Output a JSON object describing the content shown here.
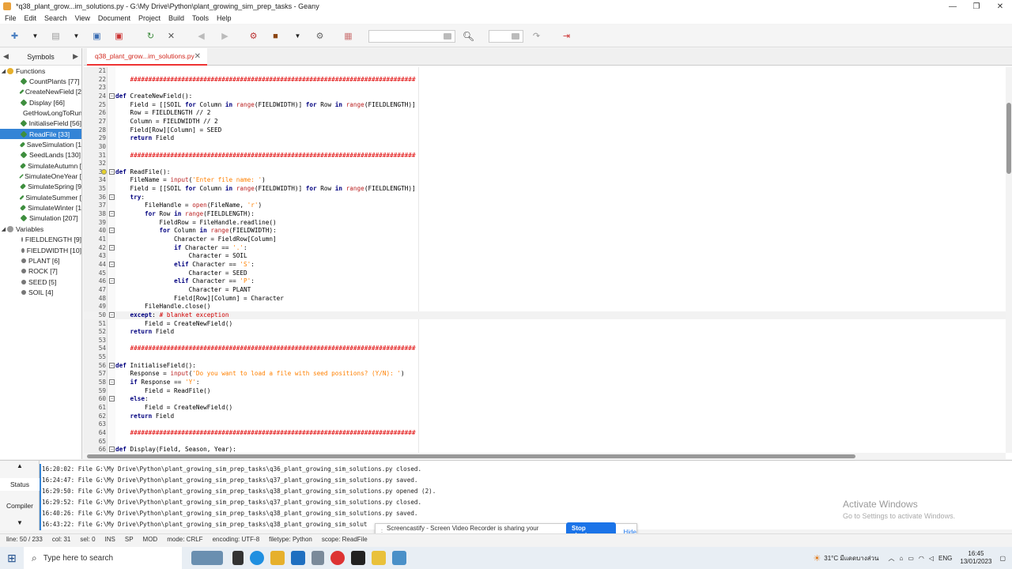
{
  "window": {
    "title": "*q38_plant_grow...im_solutions.py - G:\\My Drive\\Python\\plant_growing_sim_prep_tasks - Geany",
    "controls": [
      "—",
      "❐",
      "✕"
    ]
  },
  "menu": [
    "File",
    "Edit",
    "Search",
    "View",
    "Document",
    "Project",
    "Build",
    "Tools",
    "Help"
  ],
  "sidebar": {
    "tab_label": "Symbols",
    "groups": [
      {
        "label": "Functions",
        "items": [
          "CountPlants [77]",
          "CreateNewField [2",
          "Display [66]",
          "GetHowLongToRun",
          "InitialiseField [56]",
          "ReadFile [33]",
          "SaveSimulation [1",
          "SeedLands [130]",
          "SimulateAutumn [",
          "SimulateOneYear [",
          "SimulateSpring [9",
          "SimulateSummer [",
          "SimulateWinter [1",
          "Simulation [207]"
        ]
      },
      {
        "label": "Variables",
        "items": [
          "FIELDLENGTH [9]",
          "FIELDWIDTH [10]",
          "PLANT [6]",
          "ROCK [7]",
          "SEED [5]",
          "SOIL [4]"
        ]
      }
    ],
    "selected": "ReadFile [33]"
  },
  "editor": {
    "tab_label": "q38_plant_grow...im_solutions.py",
    "current_line": 50,
    "lines": [
      {
        "n": "21",
        "t": "",
        "f": false
      },
      {
        "n": "22",
        "t": "    ##############################################################################",
        "f": false
      },
      {
        "n": "23",
        "t": "",
        "f": false
      },
      {
        "n": "24",
        "t": "def CreateNewField():",
        "f": true
      },
      {
        "n": "25",
        "t": "    Field = [[SOIL for Column in range(FIELDWIDTH)] for Row in range(FIELDLENGTH)]",
        "f": false
      },
      {
        "n": "26",
        "t": "    Row = FIELDLENGTH // 2",
        "f": false
      },
      {
        "n": "27",
        "t": "    Column = FIELDWIDTH // 2",
        "f": false
      },
      {
        "n": "28",
        "t": "    Field[Row][Column] = SEED",
        "f": false
      },
      {
        "n": "29",
        "t": "    return Field",
        "f": false
      },
      {
        "n": "30",
        "t": "",
        "f": false
      },
      {
        "n": "31",
        "t": "    ##############################################################################",
        "f": false
      },
      {
        "n": "32",
        "t": "",
        "f": false
      },
      {
        "n": "33",
        "t": "def ReadFile():",
        "f": true
      },
      {
        "n": "34",
        "t": "    FileName = input('Enter file name: ')",
        "f": false
      },
      {
        "n": "35",
        "t": "    Field = [[SOIL for Column in range(FIELDWIDTH)] for Row in range(FIELDLENGTH)]",
        "f": false
      },
      {
        "n": "36",
        "t": "    try:",
        "f": true
      },
      {
        "n": "37",
        "t": "        FileHandle = open(FileName, 'r')",
        "f": false
      },
      {
        "n": "38",
        "t": "        for Row in range(FIELDLENGTH):",
        "f": true
      },
      {
        "n": "39",
        "t": "            FieldRow = FileHandle.readline()",
        "f": false
      },
      {
        "n": "40",
        "t": "            for Column in range(FIELDWIDTH):",
        "f": true
      },
      {
        "n": "41",
        "t": "                Character = FieldRow[Column]",
        "f": false
      },
      {
        "n": "42",
        "t": "                if Character == '.':",
        "f": true
      },
      {
        "n": "43",
        "t": "                    Character = SOIL",
        "f": false
      },
      {
        "n": "44",
        "t": "                elif Character == 'S':",
        "f": true
      },
      {
        "n": "45",
        "t": "                    Character = SEED",
        "f": false
      },
      {
        "n": "46",
        "t": "                elif Character == 'P':",
        "f": true
      },
      {
        "n": "47",
        "t": "                    Character = PLANT",
        "f": false
      },
      {
        "n": "48",
        "t": "                Field[Row][Column] = Character",
        "f": false
      },
      {
        "n": "49",
        "t": "        FileHandle.close()",
        "f": false
      },
      {
        "n": "50",
        "t": "    except: # blanket exception",
        "f": true
      },
      {
        "n": "51",
        "t": "        Field = CreateNewField()",
        "f": false
      },
      {
        "n": "52",
        "t": "    return Field",
        "f": false
      },
      {
        "n": "53",
        "t": "",
        "f": false
      },
      {
        "n": "54",
        "t": "    ##############################################################################",
        "f": false
      },
      {
        "n": "55",
        "t": "",
        "f": false
      },
      {
        "n": "56",
        "t": "def InitialiseField():",
        "f": true
      },
      {
        "n": "57",
        "t": "    Response = input('Do you want to load a file with seed positions? (Y/N): ')",
        "f": false
      },
      {
        "n": "58",
        "t": "    if Response == 'Y':",
        "f": true
      },
      {
        "n": "59",
        "t": "        Field = ReadFile()",
        "f": false
      },
      {
        "n": "60",
        "t": "    else:",
        "f": true
      },
      {
        "n": "61",
        "t": "        Field = CreateNewField()",
        "f": false
      },
      {
        "n": "62",
        "t": "    return Field",
        "f": false
      },
      {
        "n": "63",
        "t": "",
        "f": false
      },
      {
        "n": "64",
        "t": "    ##############################################################################",
        "f": false
      },
      {
        "n": "65",
        "t": "",
        "f": false
      },
      {
        "n": "66",
        "t": "def Display(Field, Season, Year):",
        "f": true
      }
    ]
  },
  "messages": {
    "tabs": [
      "Status",
      "Compiler"
    ],
    "lines": [
      "16:20:02: File G:\\My Drive\\Python\\plant_growing_sim_prep_tasks\\q36_plant_growing_sim_solutions.py closed.",
      "16:24:47: File G:\\My Drive\\Python\\plant_growing_sim_prep_tasks\\q37_plant_growing_sim_solutions.py saved.",
      "16:29:50: File G:\\My Drive\\Python\\plant_growing_sim_prep_tasks\\q38_plant_growing_sim_solutions.py opened (2).",
      "16:29:52: File G:\\My Drive\\Python\\plant_growing_sim_prep_tasks\\q37_plant_growing_sim_solutions.py closed.",
      "16:40:26: File G:\\My Drive\\Python\\plant_growing_sim_prep_tasks\\q38_plant_growing_sim_solutions.py saved.",
      "16:43:22: File G:\\My Drive\\Python\\plant_growing_sim_prep_tasks\\q38_plant_growing_sim_solut"
    ]
  },
  "activation": {
    "title": "Activate Windows",
    "subtitle": "Go to Settings to activate Windows."
  },
  "screencastify": {
    "text": "Screencastify - Screen Video Recorder is sharing your screen.",
    "stop": "Stop sharing",
    "hide": "Hide"
  },
  "statusbar": [
    "line: 50 / 233",
    "col: 31",
    "sel: 0",
    "INS",
    "SP",
    "MOD",
    "mode: CRLF",
    "encoding: UTF-8",
    "filetype: Python",
    "scope: ReadFile"
  ],
  "taskbar": {
    "search_placeholder": "Type here to search",
    "weather": "31°C มีแดดบางส่วน",
    "lang": "ENG",
    "time": "16:45",
    "date": "13/01/2023"
  },
  "colors": {
    "accent": "#3484d6",
    "tab_active": "#d2281e",
    "keyword": "#00007f",
    "string": "#ff8000",
    "comment": "#d00000",
    "hashline": "#e00000"
  }
}
